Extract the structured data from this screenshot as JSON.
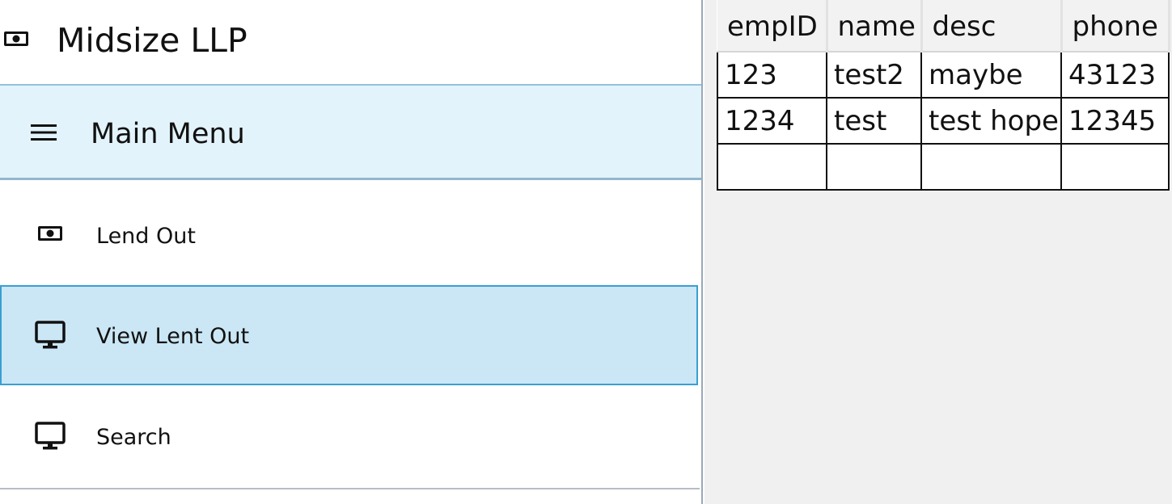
{
  "app": {
    "title": "Midsize LLP",
    "logo_icon": "money-icon"
  },
  "menu_header": {
    "label": "Main Menu",
    "icon": "hamburger-icon"
  },
  "nav_items": [
    {
      "label": "Lend Out",
      "icon": "money-icon",
      "selected": false
    },
    {
      "label": "View Lent Out",
      "icon": "monitor-icon",
      "selected": true
    },
    {
      "label": "Search",
      "icon": "monitor-icon",
      "selected": false
    }
  ],
  "grid": {
    "columns": [
      "empID",
      "name",
      "desc",
      "phone"
    ],
    "rows": [
      [
        "123",
        "test2",
        "maybe",
        "43123"
      ],
      [
        "1234",
        "test",
        "test hope",
        "12345"
      ],
      [
        "",
        "",
        "",
        ""
      ]
    ]
  },
  "colors": {
    "menu_header_bg": "#e3f3fb",
    "selected_bg": "#cbe7f5",
    "selected_border": "#3a9fd3",
    "content_bg": "#f0f0f0"
  }
}
